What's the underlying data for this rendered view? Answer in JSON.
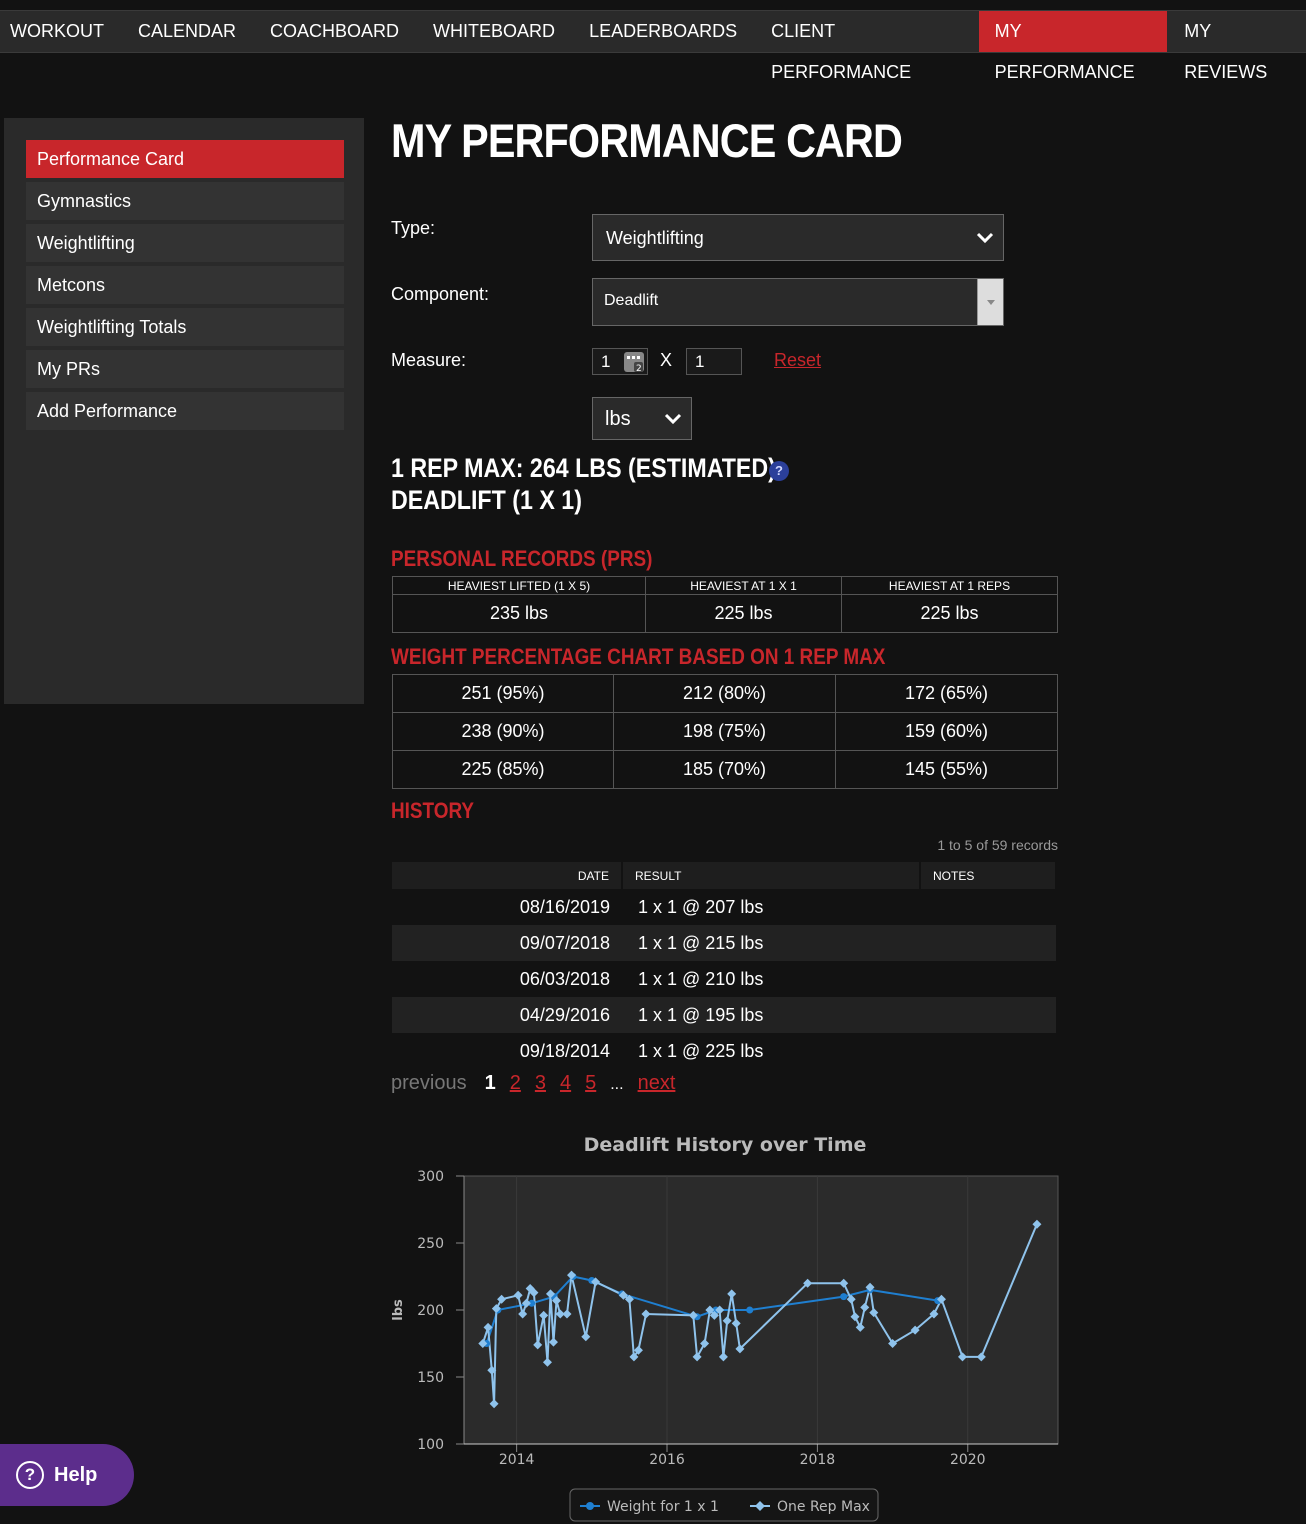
{
  "nav": {
    "items": [
      "WORKOUT",
      "CALENDAR",
      "COACHBOARD",
      "WHITEBOARD",
      "LEADERBOARDS",
      "CLIENT PERFORMANCE",
      "MY PERFORMANCE",
      "MY REVIEWS"
    ],
    "active": "MY PERFORMANCE"
  },
  "sidebar": {
    "items": [
      "Performance Card",
      "Gymnastics",
      "Weightlifting",
      "Metcons",
      "Weightlifting Totals",
      "My PRs",
      "Add Performance"
    ],
    "active": "Performance Card"
  },
  "page_title": "MY PERFORMANCE CARD",
  "form": {
    "type_label": "Type:",
    "type_value": "Weightlifting",
    "component_label": "Component:",
    "component_value": "Deadlift",
    "measure_label": "Measure:",
    "measure_sets": "1",
    "measure_x": "X",
    "measure_reps": "1",
    "reset_label": "Reset",
    "unit_value": "lbs"
  },
  "one_rep_max": {
    "line1": "1 REP MAX: 264 LBS (ESTIMATED)",
    "line2": "DEADLIFT (1 X 1)"
  },
  "prs": {
    "heading": "PERSONAL RECORDS (PRS)",
    "headers": [
      "HEAVIEST LIFTED (1 X 5)",
      "HEAVIEST AT 1 X 1",
      "HEAVIEST AT 1 REPS"
    ],
    "values": [
      "235 lbs",
      "225 lbs",
      "225 lbs"
    ]
  },
  "pct_chart": {
    "heading": "WEIGHT PERCENTAGE CHART BASED ON 1 REP MAX",
    "rows": [
      [
        "251 (95%)",
        "212 (80%)",
        "172 (65%)"
      ],
      [
        "238 (90%)",
        "198 (75%)",
        "159 (60%)"
      ],
      [
        "225 (85%)",
        "185 (70%)",
        "145 (55%)"
      ]
    ]
  },
  "history": {
    "heading": "HISTORY",
    "record_count": "1 to 5 of 59 records",
    "headers": {
      "date": "DATE",
      "result": "RESULT",
      "notes": "NOTES"
    },
    "rows": [
      {
        "date": "08/16/2019",
        "result": "1 x 1 @ 207 lbs"
      },
      {
        "date": "09/07/2018",
        "result": "1 x 1 @ 215 lbs"
      },
      {
        "date": "06/03/2018",
        "result": "1 x 1 @ 210 lbs"
      },
      {
        "date": "04/29/2016",
        "result": "1 x 1 @ 195 lbs"
      },
      {
        "date": "09/18/2014",
        "result": "1 x 1 @ 225 lbs"
      }
    ]
  },
  "pager": {
    "previous": "previous",
    "current": "1",
    "pages": [
      "2",
      "3",
      "4",
      "5"
    ],
    "ellipsis": "...",
    "next": "next"
  },
  "help": {
    "label": "Help"
  },
  "colors": {
    "accent": "#c8262b",
    "series_weight": "#1f7fd0",
    "series_orm": "#8fc3ec"
  },
  "chart_data": {
    "type": "line",
    "title": "Deadlift History over Time",
    "ylabel": "lbs",
    "xlabel": "",
    "ylim": [
      100,
      300
    ],
    "xlim": [
      2013.3,
      2021.2
    ],
    "yticks": [
      100,
      150,
      200,
      250,
      300
    ],
    "xticks": [
      2014,
      2016,
      2018,
      2020
    ],
    "legend_position": "bottom-center",
    "series": [
      {
        "name": "Weight for 1 x 1",
        "points": [
          [
            2013.6,
            175
          ],
          [
            2013.75,
            200
          ],
          [
            2014.2,
            205
          ],
          [
            2014.5,
            210
          ],
          [
            2014.75,
            225
          ],
          [
            2015.0,
            222
          ],
          [
            2015.4,
            212
          ],
          [
            2016.4,
            195
          ],
          [
            2016.65,
            200
          ],
          [
            2017.1,
            200
          ],
          [
            2018.35,
            210
          ],
          [
            2018.7,
            215
          ],
          [
            2019.6,
            207
          ]
        ]
      },
      {
        "name": "One Rep Max",
        "points": [
          [
            2013.55,
            175
          ],
          [
            2013.62,
            187
          ],
          [
            2013.67,
            155
          ],
          [
            2013.7,
            130
          ],
          [
            2013.73,
            201
          ],
          [
            2013.8,
            208
          ],
          [
            2014.02,
            211
          ],
          [
            2014.08,
            197
          ],
          [
            2014.13,
            205
          ],
          [
            2014.18,
            216
          ],
          [
            2014.23,
            213
          ],
          [
            2014.28,
            174
          ],
          [
            2014.36,
            196
          ],
          [
            2014.41,
            161
          ],
          [
            2014.45,
            212
          ],
          [
            2014.49,
            176
          ],
          [
            2014.53,
            207
          ],
          [
            2014.58,
            197
          ],
          [
            2014.67,
            197
          ],
          [
            2014.73,
            226
          ],
          [
            2014.92,
            180
          ],
          [
            2015.05,
            221
          ],
          [
            2015.42,
            211
          ],
          [
            2015.5,
            208
          ],
          [
            2015.56,
            165
          ],
          [
            2015.62,
            170
          ],
          [
            2015.72,
            197
          ],
          [
            2016.35,
            196
          ],
          [
            2016.4,
            165
          ],
          [
            2016.5,
            175
          ],
          [
            2016.57,
            200
          ],
          [
            2016.63,
            196
          ],
          [
            2016.7,
            200
          ],
          [
            2016.75,
            165
          ],
          [
            2016.8,
            192
          ],
          [
            2016.86,
            212
          ],
          [
            2016.92,
            190
          ],
          [
            2016.97,
            171
          ],
          [
            2017.87,
            220
          ],
          [
            2018.35,
            220
          ],
          [
            2018.45,
            208
          ],
          [
            2018.5,
            195
          ],
          [
            2018.57,
            187
          ],
          [
            2018.63,
            202
          ],
          [
            2018.7,
            217
          ],
          [
            2018.75,
            198
          ],
          [
            2019.0,
            175
          ],
          [
            2019.3,
            185
          ],
          [
            2019.55,
            197
          ],
          [
            2019.65,
            208
          ],
          [
            2019.93,
            165
          ],
          [
            2020.18,
            165
          ],
          [
            2020.92,
            264
          ]
        ]
      }
    ]
  }
}
